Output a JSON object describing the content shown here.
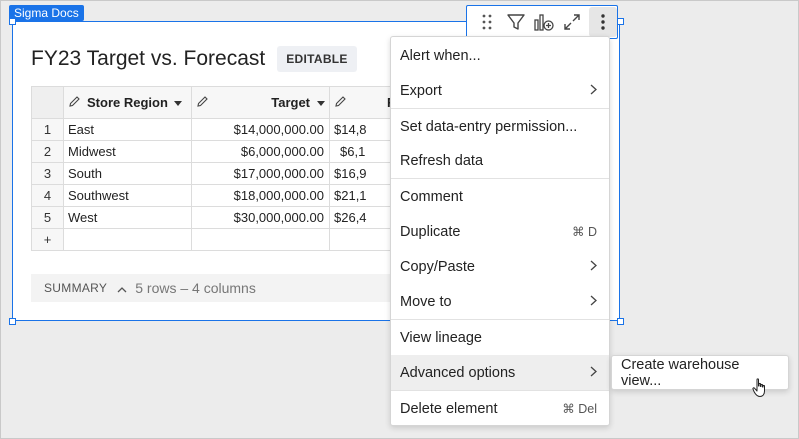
{
  "brand_tag": "Sigma Docs",
  "element": {
    "title": "FY23 Target vs. Forecast",
    "badge": "EDITABLE"
  },
  "toolbar": {
    "icons": [
      "drag-handle-icon",
      "filter-icon",
      "add-chart-icon",
      "expand-icon",
      "more-vertical-icon"
    ]
  },
  "table": {
    "columns": [
      {
        "label": "Store Region",
        "icon": "pencil-icon",
        "has_sort": true
      },
      {
        "label": "Target",
        "icon": "pencil-icon",
        "has_sort": true
      },
      {
        "label": "F",
        "icon": "pencil-icon",
        "has_sort": false
      }
    ],
    "rows": [
      {
        "num": "1",
        "region": "East",
        "target": "$14,000,000.00",
        "forecast": "$14,8"
      },
      {
        "num": "2",
        "region": "Midwest",
        "target": "$6,000,000.00",
        "forecast": "$6,1"
      },
      {
        "num": "3",
        "region": "South",
        "target": "$17,000,000.00",
        "forecast": "$16,9"
      },
      {
        "num": "4",
        "region": "Southwest",
        "target": "$18,000,000.00",
        "forecast": "$21,1"
      },
      {
        "num": "5",
        "region": "West",
        "target": "$30,000,000.00",
        "forecast": "$26,4"
      }
    ],
    "add_row_label": "+"
  },
  "summary": {
    "label": "SUMMARY",
    "text": "5 rows – 4 columns"
  },
  "context_menu": {
    "items": [
      {
        "label": "Alert when...",
        "shortcut": "",
        "submenu": false
      },
      {
        "label": "Export",
        "shortcut": "",
        "submenu": true
      },
      {
        "label": "Set data-entry permission...",
        "shortcut": "",
        "submenu": false
      },
      {
        "label": "Refresh data",
        "shortcut": "",
        "submenu": false
      },
      {
        "label": "Comment",
        "shortcut": "",
        "submenu": false
      },
      {
        "label": "Duplicate",
        "shortcut": "⌘ D",
        "submenu": false
      },
      {
        "label": "Copy/Paste",
        "shortcut": "",
        "submenu": true
      },
      {
        "label": "Move to",
        "shortcut": "",
        "submenu": true
      },
      {
        "label": "View lineage",
        "shortcut": "",
        "submenu": false
      },
      {
        "label": "Advanced options",
        "shortcut": "",
        "submenu": true
      },
      {
        "label": "Delete element",
        "shortcut": "⌘ Del",
        "submenu": false
      }
    ],
    "hovered": "Advanced options"
  },
  "submenu": {
    "items": [
      {
        "label": "Create warehouse view..."
      }
    ]
  },
  "colors": {
    "accent": "#1a73e8",
    "menu_hover": "#eeeeee"
  }
}
